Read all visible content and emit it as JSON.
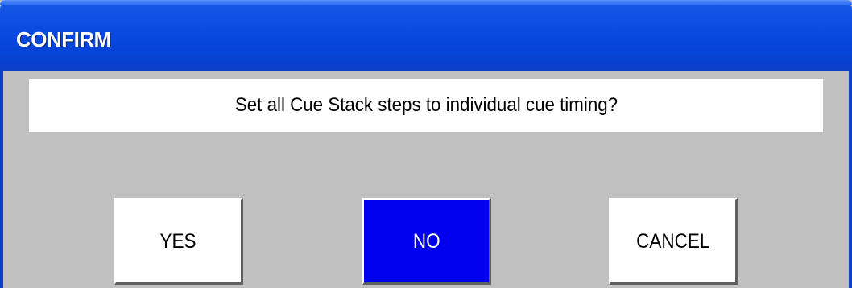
{
  "window": {
    "title": "CONFIRM"
  },
  "message": {
    "text": "Set all Cue Stack steps to individual cue timing?"
  },
  "buttons": {
    "yes_label": "YES",
    "no_label": "NO",
    "cancel_label": "CANCEL"
  },
  "colors": {
    "titlebar": "#0A4AE0",
    "dialog_background": "#C0C0C0",
    "message_background": "#FFFFFF",
    "selected_button": "#0000EE",
    "button_background": "#FFFFFF"
  }
}
